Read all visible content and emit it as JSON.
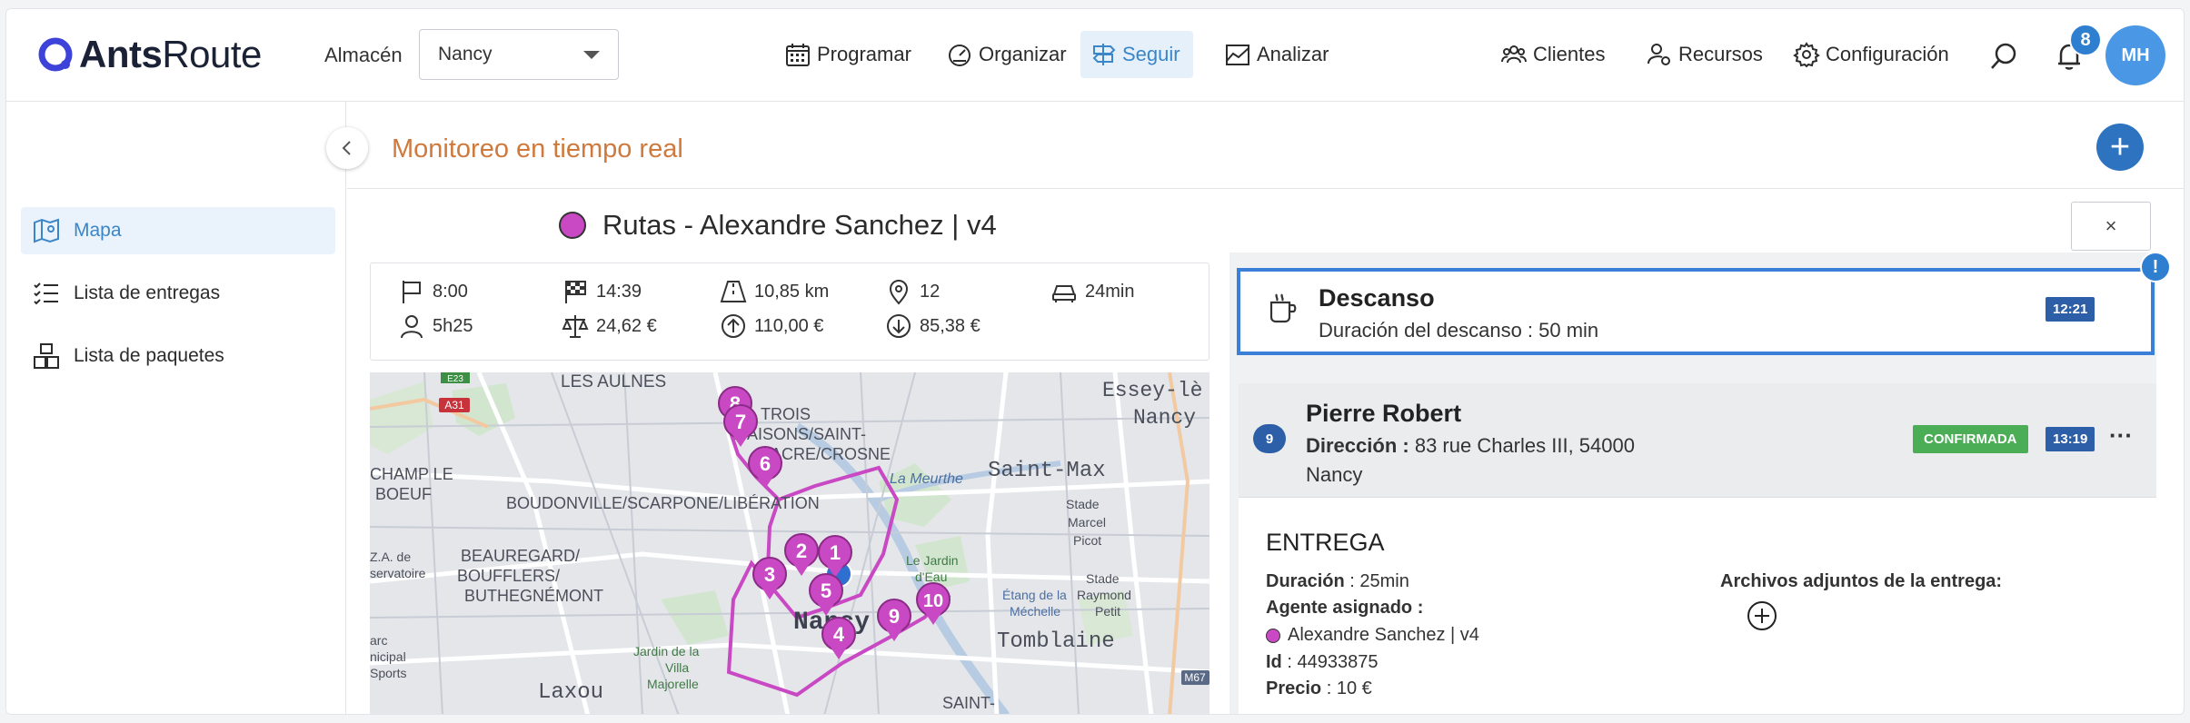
{
  "app": {
    "logo_a": "Ants",
    "logo_b": "Route"
  },
  "header": {
    "warehouse_label": "Almacén",
    "warehouse_value": "Nancy",
    "nav": [
      "Programar",
      "Organizar",
      "Seguir",
      "Analizar"
    ],
    "right_nav": [
      "Clientes",
      "Recursos",
      "Configuración"
    ],
    "notifications_count": "8",
    "avatar_initials": "MH",
    "accent": "#3a86c8"
  },
  "sidebar": {
    "items": [
      {
        "label": "Mapa",
        "icon": "map-icon",
        "active": true
      },
      {
        "label": "Lista de entregas",
        "icon": "checklist-icon",
        "active": false
      },
      {
        "label": "Lista de paquetes",
        "icon": "packages-icon",
        "active": false
      }
    ]
  },
  "page": {
    "title": "Monitoreo en tiempo real",
    "route_title": "Rutas - Alexandre Sanchez | v4",
    "close_label": "×"
  },
  "stats": {
    "start": "8:00",
    "end": "14:39",
    "distance": "10,85 km",
    "stops": "12",
    "drive_time": "24min",
    "duration": "5h25",
    "cost": "24,62 €",
    "revenue": "110,00 €",
    "margin": "85,38 €"
  },
  "map": {
    "labels": [
      "LES AULNES",
      "TROIS",
      "MAISONS/SAINT-",
      "FIACRE/CROSNE",
      "Essey-lè",
      "Nancy",
      "Saint-Max",
      "CHAMP LE",
      "BOEUF",
      "BOUDONVILLE/SCARPONE/LIBÉRATION",
      "La Meurthe",
      "Stade",
      "Marcel",
      "Picot",
      "BEAUREGARD/",
      "BOUFFLERS/",
      "BUTHEGNÉMONT",
      "Z.A. de",
      "servatoire",
      "Le Jardin",
      "d'Eau",
      "Étang de la",
      "Méchelle",
      "Stade",
      "Raymond",
      "Petit",
      "Nancy",
      "Tomblaine",
      "Jardin de la",
      "Villa",
      "Majorelle",
      "Laxou",
      "arc",
      "nicipal",
      "Sports",
      "SAINT-",
      "A31",
      "E23",
      "M67"
    ],
    "markers": [
      "8",
      "7",
      "6",
      "2",
      "1",
      "3",
      "5",
      "4",
      "9",
      "10"
    ]
  },
  "pause": {
    "title": "Descanso",
    "subtitle": "Duración del descanso : 50 min",
    "time": "12:21",
    "alert": "!"
  },
  "stop": {
    "number": "9",
    "name": "Pierre Robert",
    "address_label": "Dirección :",
    "address": "83 rue Charles III, 54000",
    "city": "Nancy",
    "status": "CONFIRMADA",
    "time": "13:19",
    "more": "···",
    "section": "ENTREGA",
    "duration_label": "Duración",
    "duration": ": 25min",
    "agent_label": "Agente asignado :",
    "agent": "Alexandre Sanchez | v4",
    "id_label": "Id",
    "id": ": 44933875",
    "price_label": "Precio",
    "price": ": 10 €",
    "attachments_label": "Archivos adjuntos de la entrega:"
  }
}
